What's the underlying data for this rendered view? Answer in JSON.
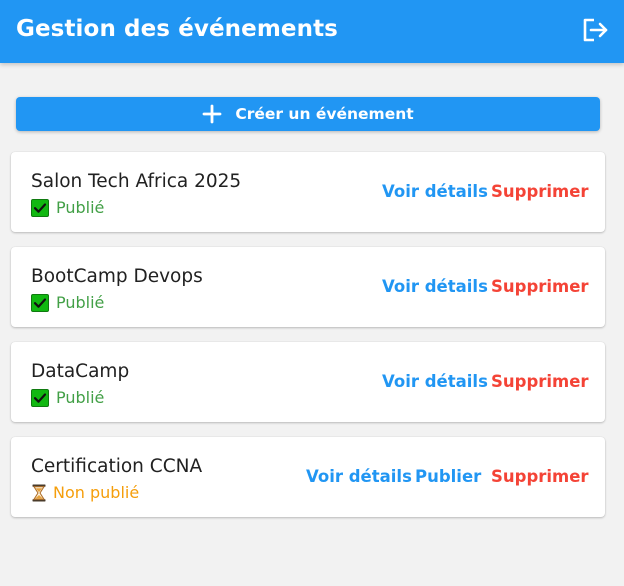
{
  "header": {
    "title": "Gestion des événements",
    "logout_icon": "logout-icon",
    "background": "#2196f3"
  },
  "create_button": {
    "label": "Créer un événement",
    "icon": "plus-icon"
  },
  "colors": {
    "primary": "#2196f3",
    "danger": "#f44336",
    "published": "#43a047",
    "unpublished": "#f59e0b"
  },
  "events": [
    {
      "title": "Salon Tech Africa 2025",
      "status": "Publié",
      "status_icon": "check-box-icon",
      "actions": {
        "details": "Voir détails",
        "delete": "Supprimer"
      }
    },
    {
      "title": "BootCamp Devops",
      "status": "Publié",
      "status_icon": "check-box-icon",
      "actions": {
        "details": "Voir détails",
        "delete": "Supprimer"
      }
    },
    {
      "title": "DataCamp",
      "status": "Publié",
      "status_icon": "check-box-icon",
      "actions": {
        "details": "Voir détails",
        "delete": "Supprimer"
      }
    },
    {
      "title": "Certification CCNA",
      "status": "Non publié",
      "status_icon": "hourglass-icon",
      "actions": {
        "details": "Voir détails",
        "publish": "Publier",
        "delete": "Supprimer"
      }
    }
  ]
}
